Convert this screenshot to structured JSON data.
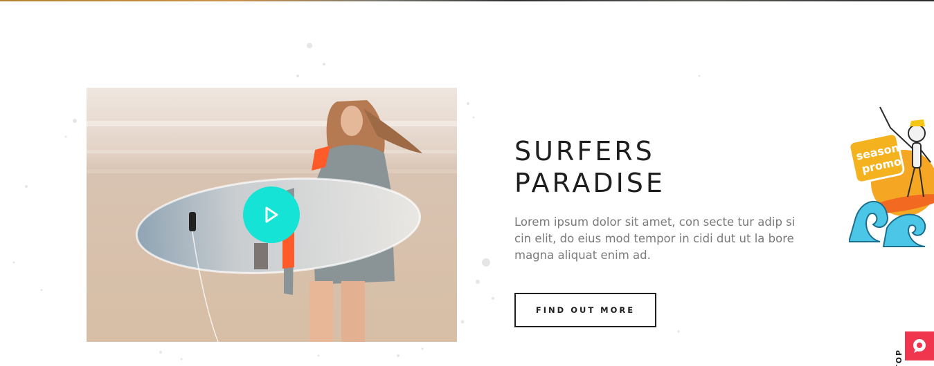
{
  "hero": {
    "title_line1": "SURFERS",
    "title_line2": "PARADISE",
    "description": "Lorem ipsum dolor sit amet, con secte tur adip si cin elit, do eius mod tempor in cidi dut ut la bore magna aliquat enim ad.",
    "cta_label": "FIND OUT MORE"
  },
  "video": {
    "play_icon": "play-icon",
    "accent_color": "#14e3d6"
  },
  "promo": {
    "sticker_text_line1": "season",
    "sticker_text_line2": "promo"
  },
  "utility": {
    "back_to_top_label": "TOP",
    "help_icon": "chat-bubble-icon",
    "help_color": "#f0364f"
  }
}
